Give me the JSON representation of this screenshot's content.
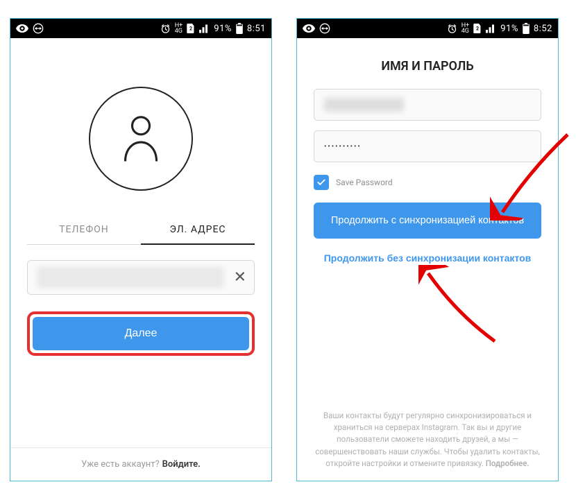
{
  "statusbar": {
    "battery": "91%",
    "time_left": "8:51",
    "time_right": "8:52"
  },
  "left": {
    "tabs": {
      "phone": "ТЕЛЕФОН",
      "email": "ЭЛ. АДРЕС"
    },
    "email_value": "",
    "next_btn": "Далее",
    "footer_prompt": "Уже есть аккаунт?",
    "footer_login": "Войдите."
  },
  "right": {
    "title": "ИМЯ И ПАРОЛЬ",
    "name_value": "",
    "password_dots": "••••••••••",
    "save_pw_label": "Save Password",
    "continue_sync": "Продолжить с синхронизацией контактов",
    "continue_nosync": "Продолжить без синхронизации контактов",
    "disclaimer": "Ваши контакты будут регулярно синхронизироваться и храниться на серверах Instagram. Так вы и другие пользователи сможете находить друзей, а мы — совершенствовать наши службы. Чтобы удалить контакты, откройте настройки и отмените привязку. ",
    "more": "Подробнее."
  }
}
